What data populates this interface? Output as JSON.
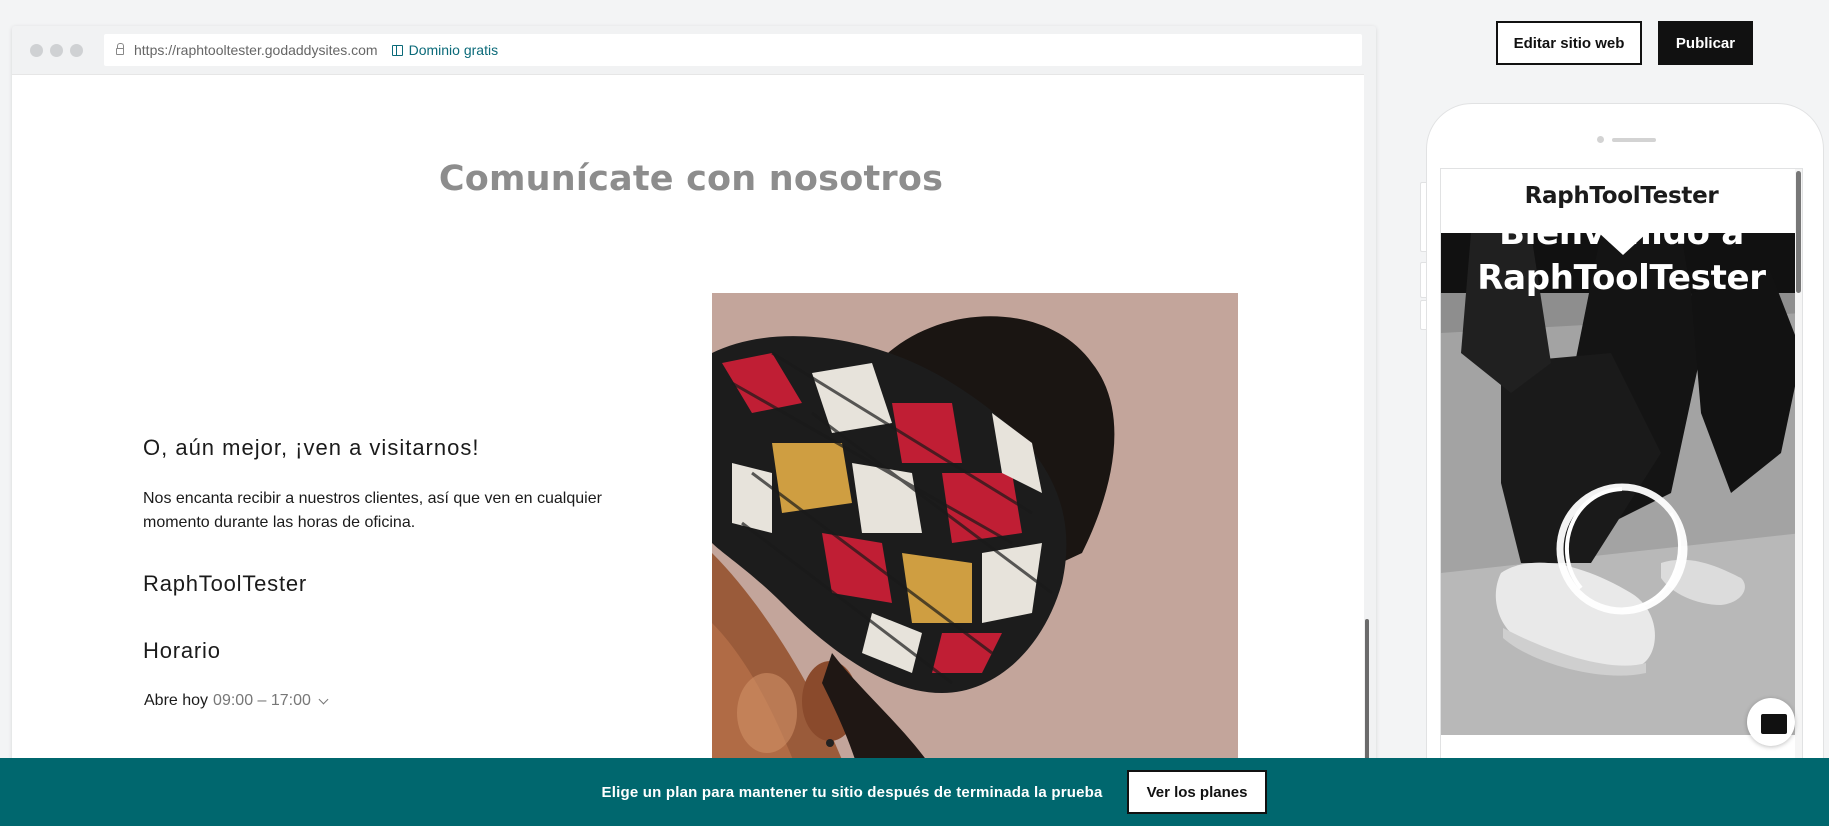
{
  "browser": {
    "url": "https://raphtooltester.godaddysites.com",
    "domain_link": "Dominio gratis"
  },
  "desktop": {
    "section_title": "Comunícate con nosotros",
    "visit_heading": "O, aún mejor, ¡ven a visitarnos!",
    "visit_text": "Nos encanta recibir a nuestros clientes, así que ven en cualquier momento durante las horas de oficina.",
    "business_name": "RaphToolTester",
    "hours_heading": "Horario",
    "hours_label": "Abre hoy",
    "hours_time": "09:00 – 17:00"
  },
  "toolbar": {
    "edit_label": "Editar sitio web",
    "publish_label": "Publicar"
  },
  "mobile": {
    "site_title": "RaphToolTester",
    "hero_line1": "Bienvenido a",
    "hero_line2": "RaphToolTester"
  },
  "banner": {
    "text": "Elige un plan para mantener tu sitio después de terminada la prueba",
    "button_label": "Ver los planes"
  },
  "colors": {
    "banner": "#00676e",
    "link": "#0b6a79",
    "button_dark": "#111111"
  }
}
